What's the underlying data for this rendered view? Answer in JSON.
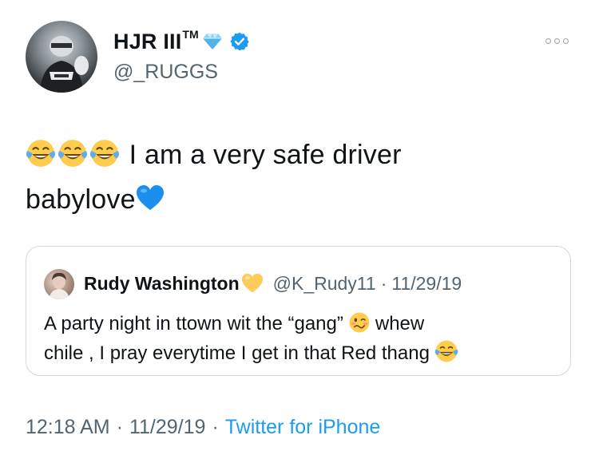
{
  "author": {
    "display_name": "HJR III",
    "trademark": "TM",
    "handle": "@_RUGGS",
    "verified": true
  },
  "tweet": {
    "text_line1": "I am a very safe driver",
    "text_line2": "babylove",
    "emoji_prefix": [
      "face-with-tears-of-joy",
      "face-with-tears-of-joy",
      "face-with-tears-of-joy"
    ],
    "emoji_suffix": "blue-heart"
  },
  "quoted": {
    "name": "Rudy Washington",
    "name_emoji": "yellow-heart",
    "handle": "@K_Rudy11",
    "separator": "·",
    "date": "11/29/19",
    "text_part1": "A party night in ttown wit the “gang”",
    "text_part2": "whew",
    "text_line2": "chile , I pray everytime I get in that Red thang",
    "emoji_mid": "woozy-face",
    "emoji_end": "face-with-tears-of-joy"
  },
  "meta": {
    "time": "12:18 AM",
    "separator": "·",
    "date": "11/29/19",
    "source": "Twitter for iPhone"
  },
  "colors": {
    "text": "#0f1419",
    "muted": "#536471",
    "link": "#1d9bf0",
    "border": "#cfd9de"
  }
}
